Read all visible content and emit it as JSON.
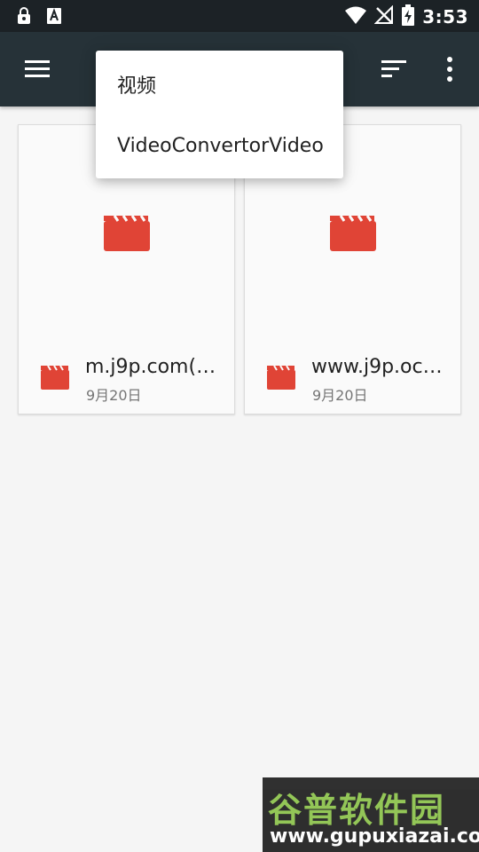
{
  "status_bar": {
    "left_icons": [
      "lock-icon",
      "a-notification-icon"
    ],
    "right_icons": [
      "wifi-icon",
      "no-signal-icon",
      "battery-charging-icon"
    ],
    "time": "3:53"
  },
  "app_bar": {
    "menu_icon": "hamburger-menu-icon",
    "sort_icon": "sort-icon",
    "more_icon": "more-vert-icon",
    "background": "#263238"
  },
  "popup_menu": {
    "items": [
      "视频",
      "VideoConvertorVideo"
    ]
  },
  "files": [
    {
      "title": "m.j9p.com(1…",
      "date": "9月20日",
      "icon": "video-clapperboard-icon"
    },
    {
      "title": "www.j9p.oc…",
      "date": "9月20日",
      "icon": "video-clapperboard-icon"
    }
  ],
  "accent_color": "#e04436",
  "watermark": {
    "top_text": "谷普软件园",
    "bottom_text": "www.gupuxiazai.com"
  }
}
